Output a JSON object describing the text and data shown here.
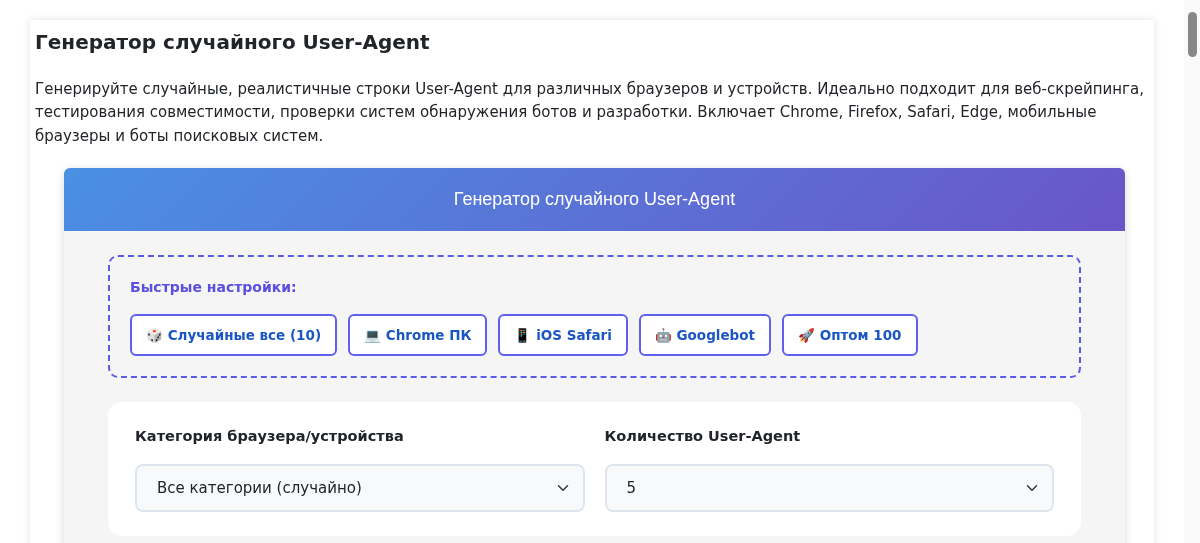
{
  "page": {
    "title": "Генератор случайного User-Agent",
    "description": "Генерируйте случайные, реалистичные строки User-Agent для различных браузеров и устройств. Идеально подходит для веб-скрейпинга, тестирования совместимости, проверки систем обнаружения ботов и разработки. Включает Chrome, Firefox, Safari, Edge, мобильные браузеры и боты поисковых систем."
  },
  "tool": {
    "header": "Генератор случайного User-Agent",
    "quick_settings": {
      "label": "Быстрые настройки:",
      "buttons": [
        {
          "label": "🎲 Случайные все (10)"
        },
        {
          "label": "💻 Chrome ПК"
        },
        {
          "label": "📱 iOS Safari"
        },
        {
          "label": "🤖 Googlebot"
        },
        {
          "label": "🚀 Оптом 100"
        }
      ]
    },
    "fields": [
      {
        "label": "Категория браузера/устройства",
        "value": "Все категории (случайно)"
      },
      {
        "label": "Количество User-Agent",
        "value": "5"
      }
    ]
  }
}
